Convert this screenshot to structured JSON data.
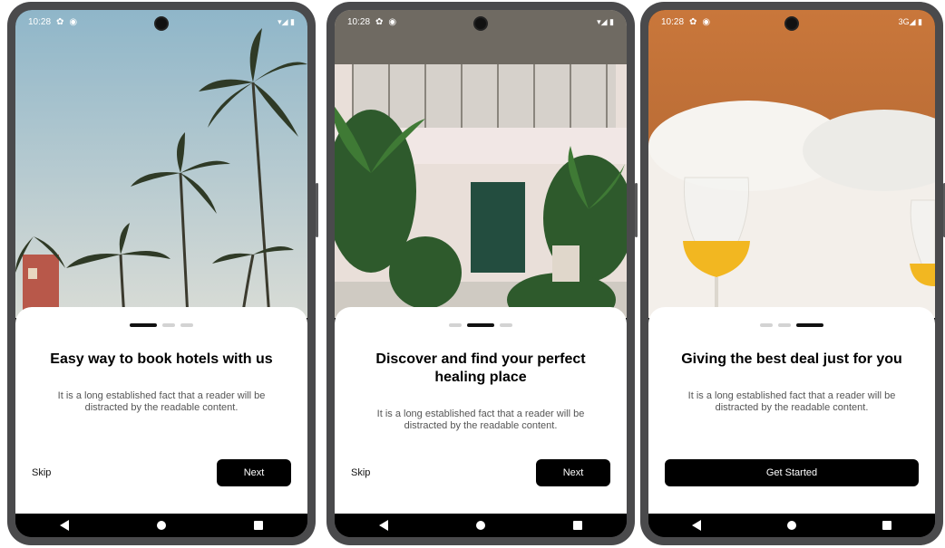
{
  "screens": [
    {
      "time": "10:28",
      "status_right": "▾◢ ▮",
      "active_dot": 0,
      "title": "Easy way to book hotels with us",
      "description": "It is a long established fact that a reader will be distracted by the readable content.",
      "skip_label": "Skip",
      "primary_label": "Next"
    },
    {
      "time": "10:28",
      "status_right": "▾◢ ▮",
      "active_dot": 1,
      "title": "Discover and find your perfect healing place",
      "description": "It is a long established fact that a reader will be distracted by the readable content.",
      "skip_label": "Skip",
      "primary_label": "Next"
    },
    {
      "time": "10:28",
      "status_right": "3G◢ ▮",
      "active_dot": 2,
      "title": "Giving the best deal just for you",
      "description": "It is a long established fact that a reader will be distracted by the readable content.",
      "primary_label": "Get Started"
    }
  ],
  "colors": {
    "button": "#000000",
    "card": "#ffffff",
    "dot_inactive": "#d3d3d3",
    "dot_active": "#111111"
  }
}
